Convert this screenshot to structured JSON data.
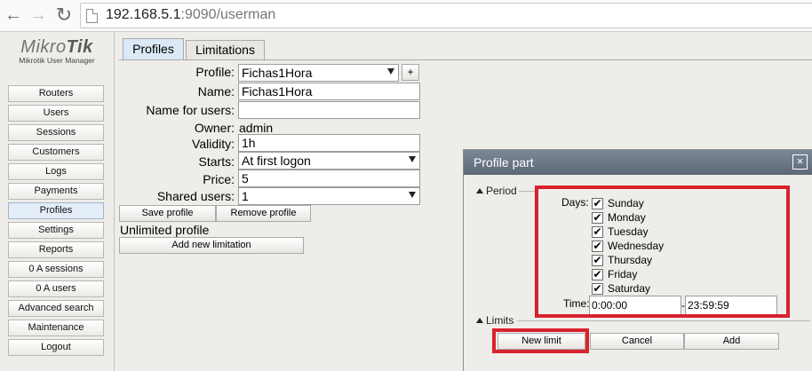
{
  "browser": {
    "url_host": "192.168.5.1",
    "url_rest": ":9090/userman"
  },
  "logo": {
    "brand_light": "Mikro",
    "brand_bold": "Tik",
    "subtitle": "Mikrotik User Manager"
  },
  "sidebar": {
    "items": [
      {
        "label": "Routers"
      },
      {
        "label": "Users"
      },
      {
        "label": "Sessions"
      },
      {
        "label": "Customers"
      },
      {
        "label": "Logs"
      },
      {
        "label": "Payments"
      },
      {
        "label": "Profiles",
        "active": true
      },
      {
        "label": "Settings"
      },
      {
        "label": "Reports"
      },
      {
        "label": "0 A sessions"
      },
      {
        "label": "0 A users"
      },
      {
        "label": "Advanced search"
      },
      {
        "label": "Maintenance"
      },
      {
        "label": "Logout"
      }
    ]
  },
  "tabs": [
    {
      "label": "Profiles",
      "active": true
    },
    {
      "label": "Limitations",
      "active": false
    }
  ],
  "form": {
    "profile_label": "Profile:",
    "profile_value": "Fichas1Hora",
    "plus_label": "+",
    "name_label": "Name:",
    "name_value": "Fichas1Hora",
    "name_for_users_label": "Name for users:",
    "name_for_users_value": "",
    "owner_label": "Owner:",
    "owner_value": "admin",
    "validity_label": "Validity:",
    "validity_value": "1h",
    "starts_label": "Starts:",
    "starts_value": "At first logon",
    "price_label": "Price:",
    "price_value": "5",
    "shared_users_label": "Shared users:",
    "shared_users_value": "1",
    "save_profile": "Save profile",
    "remove_profile": "Remove profile",
    "unlimited_profile": "Unlimited profile",
    "add_new_limitation": "Add new limitation"
  },
  "dialog": {
    "title": "Profile part",
    "close": "×",
    "period_label": "Period",
    "days_label": "Days:",
    "days": [
      {
        "name": "Sunday",
        "checked": true
      },
      {
        "name": "Monday",
        "checked": true
      },
      {
        "name": "Tuesday",
        "checked": true
      },
      {
        "name": "Wednesday",
        "checked": true
      },
      {
        "name": "Thursday",
        "checked": true
      },
      {
        "name": "Friday",
        "checked": true
      },
      {
        "name": "Saturday",
        "checked": true
      }
    ],
    "check_mark": "✔",
    "time_label": "Time:",
    "time_from": "0:00:00",
    "time_separator": "-",
    "time_to": "23:59:59",
    "limits_label": "Limits",
    "new_limit": "New limit",
    "cancel": "Cancel",
    "add": "Add"
  },
  "colors": {
    "highlight_red": "#d9222d",
    "dialog_title_bg": "#687382",
    "active_tab": "#dbe8f5"
  }
}
